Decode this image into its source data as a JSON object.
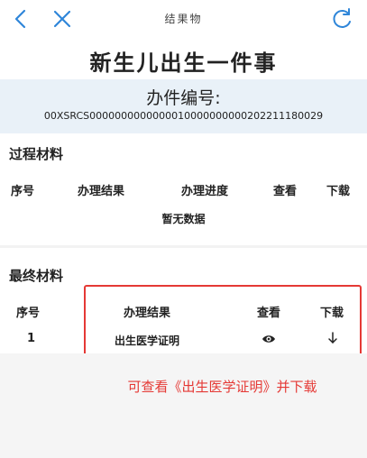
{
  "nav": {
    "title": "结果物",
    "back_icon": "chevron-left-icon",
    "close_icon": "close-icon",
    "refresh_icon": "refresh-icon",
    "accent_color": "#2f86d9"
  },
  "page": {
    "title": "新生儿出生一件事"
  },
  "case_number": {
    "label": "办件编号:",
    "value": "00XSRCS0000000000000010000000000202211180029"
  },
  "process_materials": {
    "title": "过程材料",
    "columns": [
      "序号",
      "办理结果",
      "办理进度",
      "查看",
      "下载"
    ],
    "empty_text": "暂无数据"
  },
  "final_materials": {
    "title": "最终材料",
    "columns": [
      "序号",
      "办理结果",
      "查看",
      "下载"
    ],
    "rows": [
      {
        "index": "1",
        "result": "出生医学证明",
        "view_icon": "eye-icon",
        "download_icon": "download-arrow-icon"
      }
    ]
  },
  "annotation": {
    "text": "可查看《出生医学证明》并下载",
    "color": "#e53935"
  }
}
